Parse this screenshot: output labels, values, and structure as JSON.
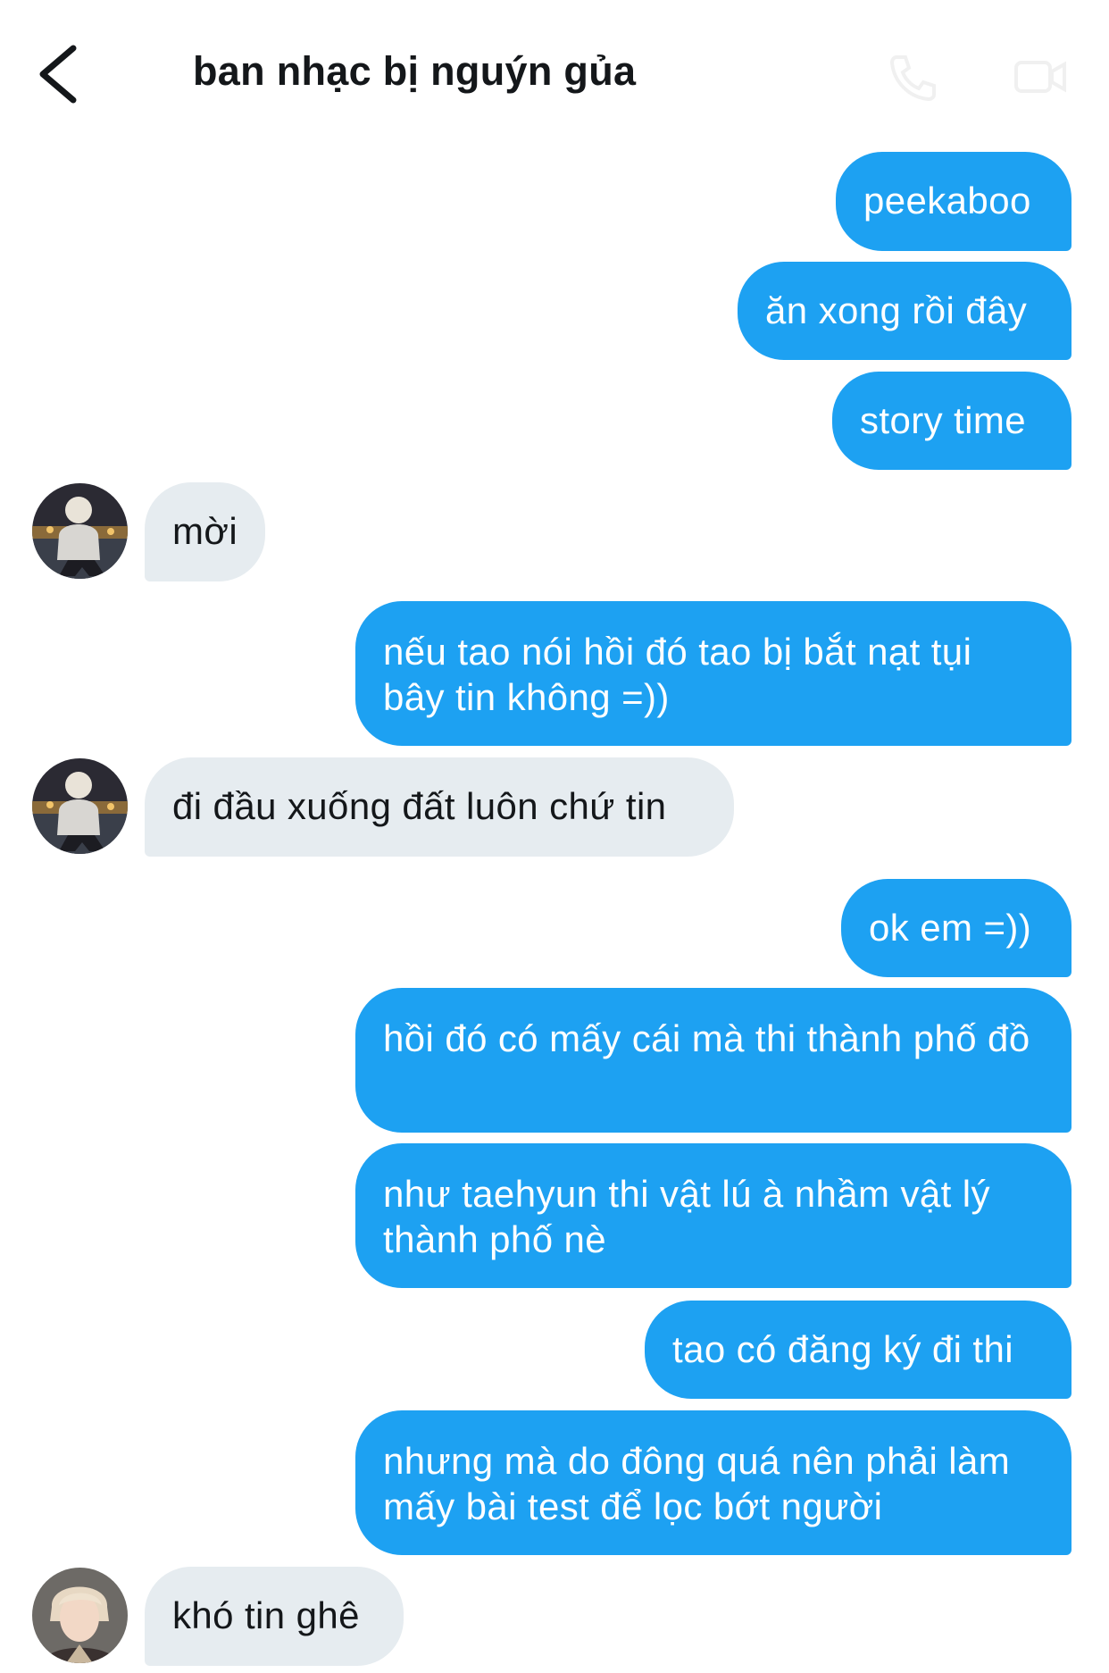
{
  "header": {
    "title": "ban nhạc bị nguýn gủa",
    "back_icon": "chevron-left-icon",
    "call_icon": "phone-icon",
    "video_icon": "video-icon"
  },
  "colors": {
    "outgoing_bubble": "#1da1f2",
    "incoming_bubble": "#e6ecf0",
    "text_dark": "#14171a"
  },
  "messages": [
    {
      "dir": "out",
      "text": "peekaboo"
    },
    {
      "dir": "out",
      "text": "ăn xong rồi đây"
    },
    {
      "dir": "out",
      "text": "story time"
    },
    {
      "dir": "in",
      "text": "mời",
      "avatar": "avatar-1"
    },
    {
      "dir": "out",
      "text": "nếu tao nói hồi đó tao bị bắt nạt tụi bây tin không =))"
    },
    {
      "dir": "in",
      "text": "đi đầu xuống đất luôn chứ tin",
      "avatar": "avatar-1"
    },
    {
      "dir": "out",
      "text": "ok em =))"
    },
    {
      "dir": "out",
      "text": "hồi đó có mấy cái mà thi thành phố đồ"
    },
    {
      "dir": "out",
      "text": "như taehyun thi vật lú à nhầm vật lý thành phố nè"
    },
    {
      "dir": "out",
      "text": "tao có đăng ký đi thi"
    },
    {
      "dir": "out",
      "text": "nhưng mà do đông quá nên phải làm mấy bài test để lọc bớt người"
    },
    {
      "dir": "in",
      "text": "khó tin ghê",
      "avatar": "avatar-2"
    }
  ]
}
